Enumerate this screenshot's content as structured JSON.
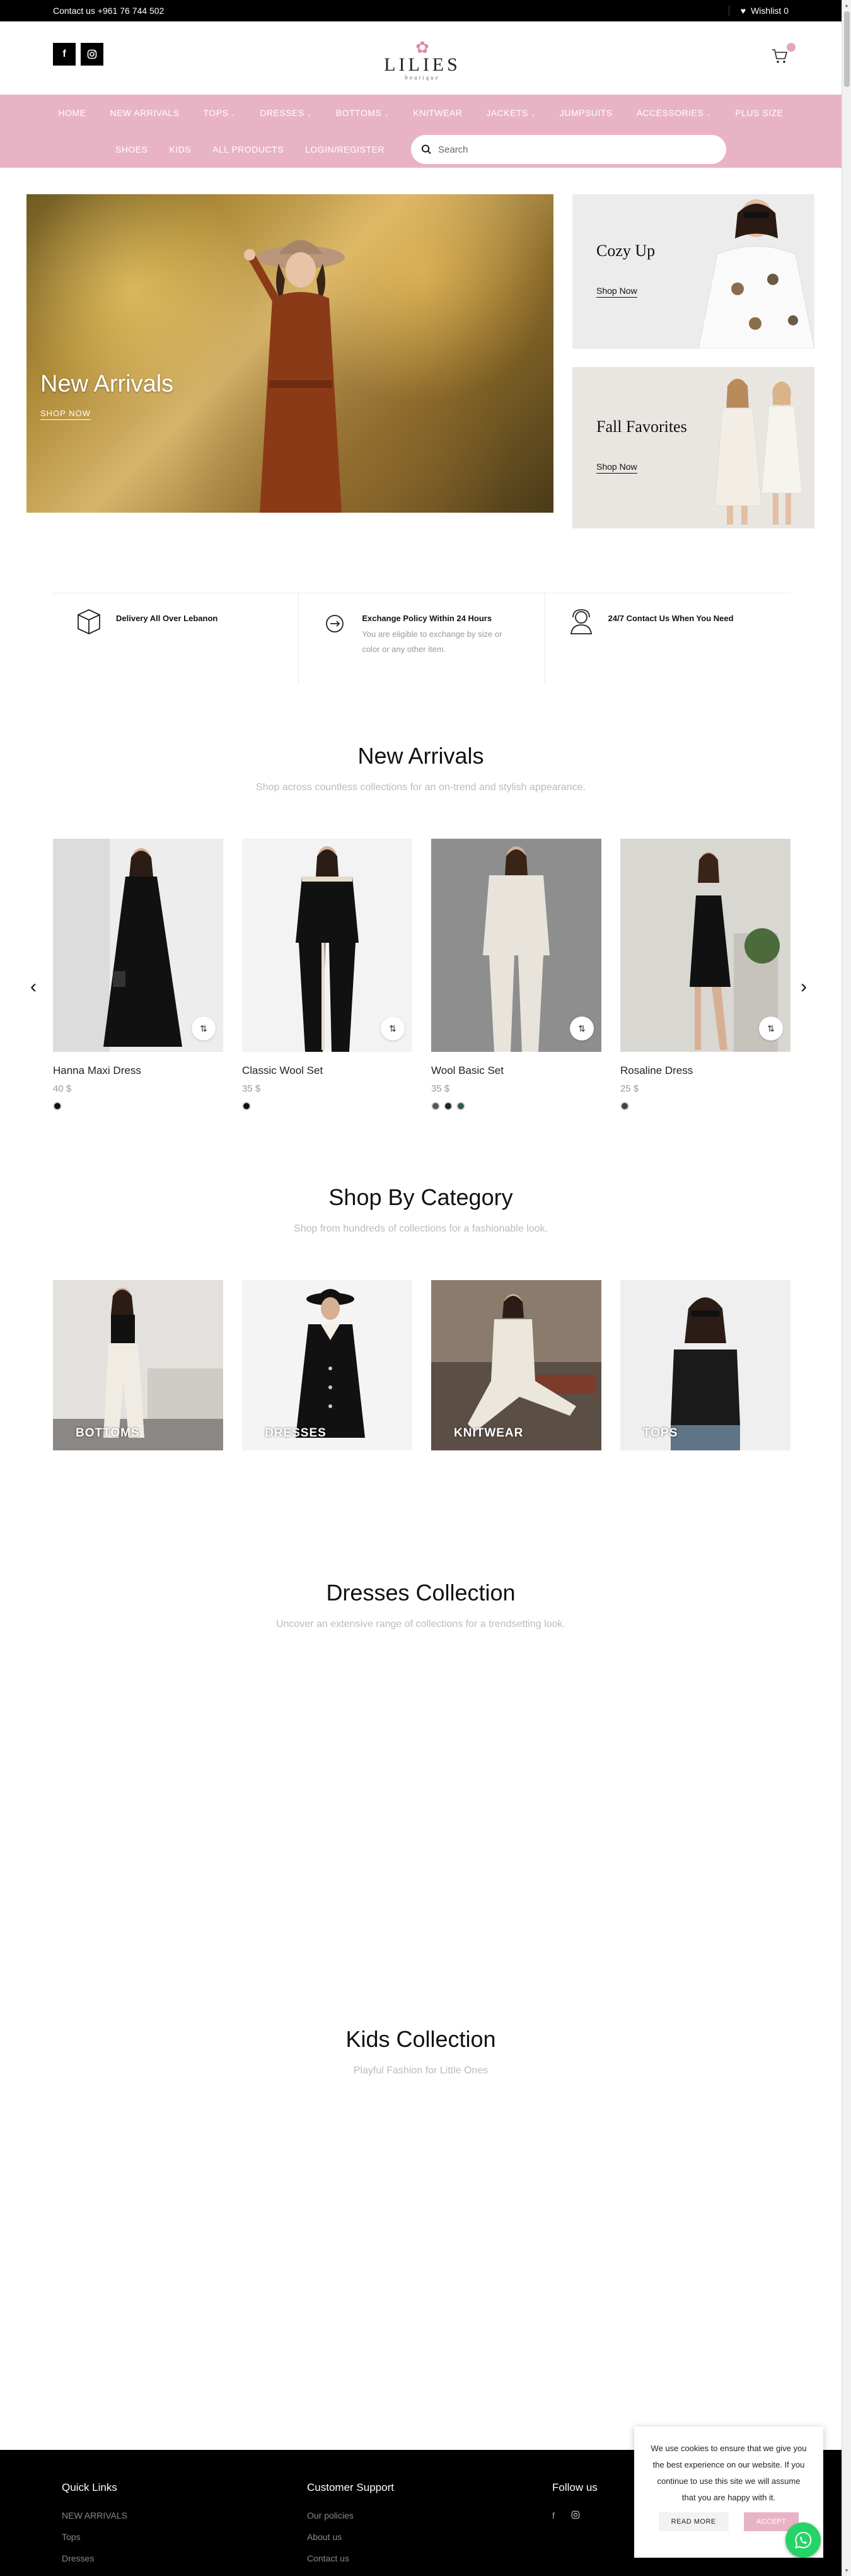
{
  "topbar": {
    "contact": "Contact us +961 76 744 502",
    "wishlist": "Wishlist 0"
  },
  "header": {
    "logo_name": "LILIES",
    "logo_sub": "boutique"
  },
  "nav": {
    "row1": [
      {
        "label": "HOME",
        "has_sub": false
      },
      {
        "label": "NEW ARRIVALS",
        "has_sub": false
      },
      {
        "label": "TOPS",
        "has_sub": true
      },
      {
        "label": "DRESSES",
        "has_sub": true
      },
      {
        "label": "BOTTOMS",
        "has_sub": true
      },
      {
        "label": "KNITWEAR",
        "has_sub": false
      },
      {
        "label": "JACKETS",
        "has_sub": true
      },
      {
        "label": "JUMPSUITS",
        "has_sub": false
      },
      {
        "label": "ACCESSORIES",
        "has_sub": true
      },
      {
        "label": "PLUS SIZE",
        "has_sub": false
      }
    ],
    "row2": [
      "SHOES",
      "KIDS",
      "ALL PRODUCTS",
      "LOGIN/REGISTER"
    ],
    "search_placeholder": "Search"
  },
  "hero": {
    "main_title": "New Arrivals",
    "main_cta": "SHOP NOW",
    "promo1_title": "Cozy Up",
    "promo1_link": "Shop Now",
    "promo2_title": "Fall Favorites",
    "promo2_link": "Shop Now"
  },
  "features": [
    {
      "title": "Delivery All Over Lebanon",
      "desc": ""
    },
    {
      "title": "Exchange Policy Within 24 Hours",
      "desc": "You are eligible to exchange by size or color or any other item."
    },
    {
      "title": "24/7 Contact Us When You Need",
      "desc": ""
    }
  ],
  "new_arrivals": {
    "title": "New Arrivals",
    "subtitle": "Shop across countless collections for an on-trend and stylish appearance.",
    "products": [
      {
        "name": "Hanna Maxi Dress",
        "price": "40 $",
        "swatches": [
          "#111111"
        ]
      },
      {
        "name": "Classic Wool Set",
        "price": "35 $",
        "swatches": [
          "#111111"
        ]
      },
      {
        "name": "Wool Basic Set",
        "price": "35 $",
        "swatches": [
          "#555555",
          "#222222",
          "#2e5b4a"
        ]
      },
      {
        "name": "Rosaline Dress",
        "price": "25 $",
        "swatches": [
          "#444444"
        ]
      }
    ]
  },
  "categories": {
    "title": "Shop By Category",
    "subtitle": "Shop from hundreds of collections for a fashionable look.",
    "items": [
      "BOTTOMS",
      "DRESSES",
      "KNITWEAR",
      "TOPS"
    ]
  },
  "dresses": {
    "title": "Dresses Collection",
    "subtitle": "Uncover an extensive range of collections for a trendsetting look."
  },
  "kids": {
    "title": "Kids Collection",
    "subtitle": "Playful Fashion for Little Ones"
  },
  "footer": {
    "quick_links_title": "Quick Links",
    "quick_links": [
      "NEW ARRIVALS",
      "Tops",
      "Dresses"
    ],
    "support_title": "Customer Support",
    "support_links": [
      "Our policies",
      "About us",
      "Contact us"
    ],
    "follow_title": "Follow us"
  },
  "cookie": {
    "text": "We use cookies to ensure that we give you the best experience on our website. If you continue to use this site we will assume that you are happy with it.",
    "read_more": "READ MORE",
    "accept": "ACCEPT"
  },
  "colors": {
    "brand_pink": "#e8b4c5",
    "topbar": "#000000",
    "whatsapp": "#25d366"
  }
}
